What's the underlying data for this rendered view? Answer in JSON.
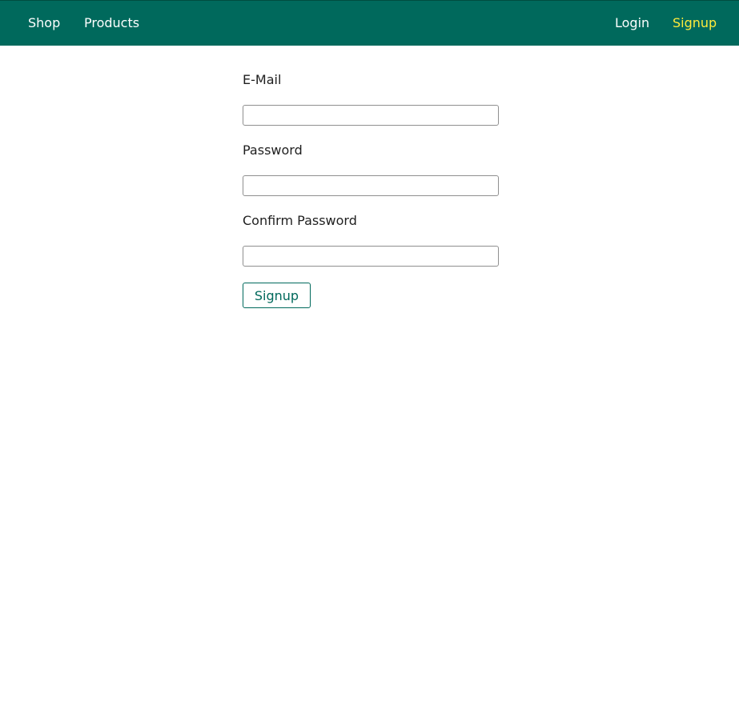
{
  "header": {
    "nav_left": [
      {
        "label": "Shop"
      },
      {
        "label": "Products"
      }
    ],
    "nav_right": [
      {
        "label": "Login"
      },
      {
        "label": "Signup",
        "active": true
      }
    ],
    "colors": {
      "background": "#00695c",
      "link": "#ffffff",
      "active_link": "#ffeb3b"
    }
  },
  "form": {
    "email": {
      "label": "E-Mail",
      "value": "",
      "placeholder": ""
    },
    "password": {
      "label": "Password",
      "value": "",
      "placeholder": ""
    },
    "confirm_password": {
      "label": "Confirm Password",
      "value": "",
      "placeholder": ""
    },
    "submit_label": "Signup"
  }
}
